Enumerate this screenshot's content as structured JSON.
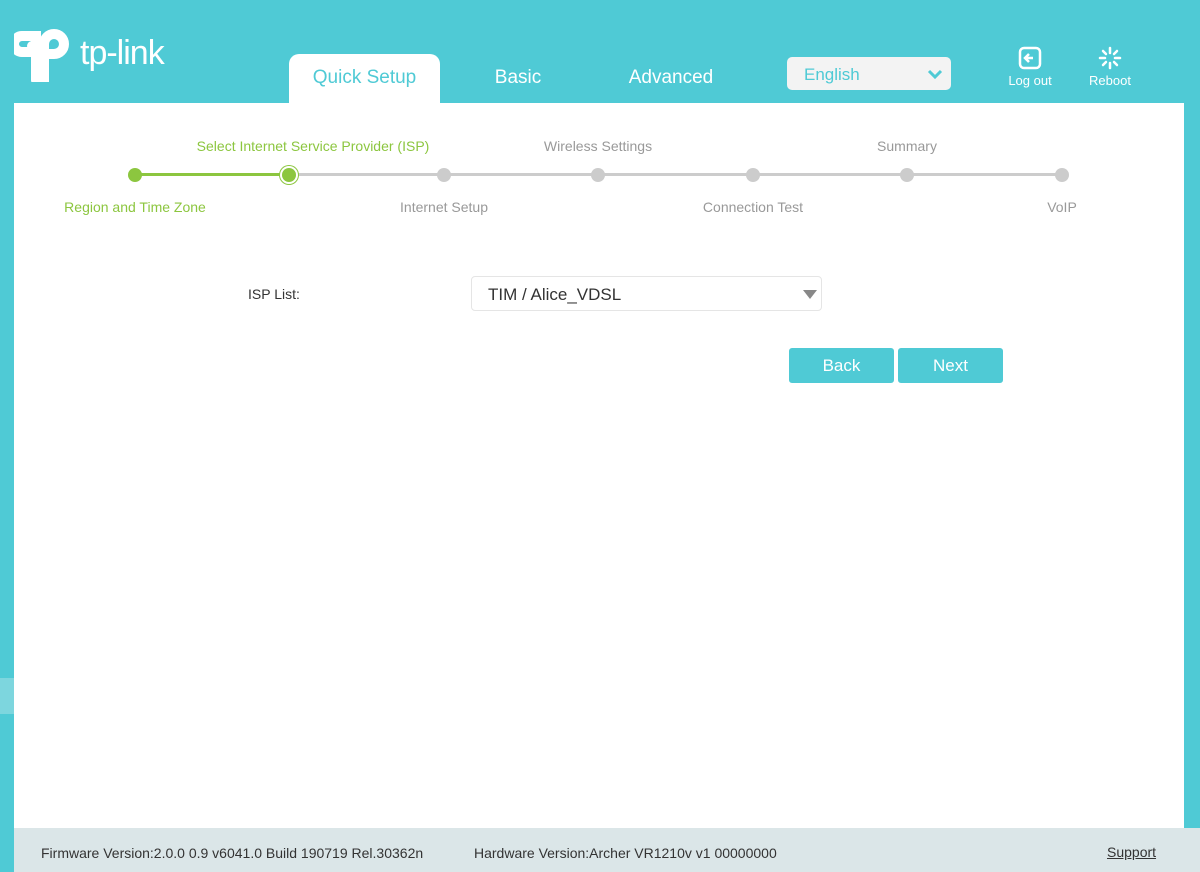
{
  "brand": "tp-link",
  "nav": {
    "tabs": [
      {
        "label": "Quick Setup"
      },
      {
        "label": "Basic"
      },
      {
        "label": "Advanced"
      }
    ],
    "language": "English",
    "logout": "Log out",
    "reboot": "Reboot"
  },
  "steps": [
    {
      "label": "Region and Time Zone",
      "state": "done"
    },
    {
      "label": "Select Internet Service Provider (ISP)",
      "state": "current"
    },
    {
      "label": "Internet Setup",
      "state": "todo"
    },
    {
      "label": "Wireless Settings",
      "state": "todo"
    },
    {
      "label": "Connection Test",
      "state": "todo"
    },
    {
      "label": "Summary",
      "state": "todo"
    },
    {
      "label": "VoIP",
      "state": "todo"
    }
  ],
  "form": {
    "isp_label": "ISP List:",
    "isp_value": "TIM / Alice_VDSL",
    "back": "Back",
    "next": "Next"
  },
  "footer": {
    "firmware": "Firmware Version:2.0.0 0.9 v6041.0 Build 190719 Rel.30362n",
    "hardware": "Hardware Version:Archer VR1210v v1 00000000",
    "support": "Support"
  },
  "colors": {
    "accent": "#4fcad5",
    "progress": "#8cc63f"
  }
}
